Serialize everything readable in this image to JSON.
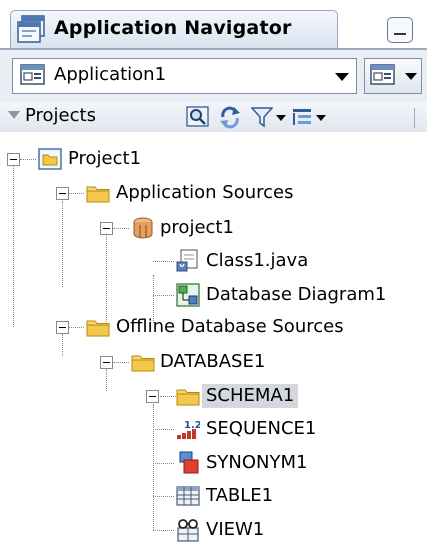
{
  "panel": {
    "title": "Application Navigator"
  },
  "app_selector": {
    "value": "Application1"
  },
  "projects_header": {
    "label": "Projects"
  },
  "tree": {
    "project1_root": "Project1",
    "app_sources": "Application Sources",
    "project1_pkg": "project1",
    "class_file": "Class1.java",
    "db_diagram": "Database Diagram1",
    "offline_db": "Offline Database Sources",
    "database": "DATABASE1",
    "schema": "SCHEMA1",
    "sequence": "SEQUENCE1",
    "synonym": "SYNONYM1",
    "table": "TABLE1",
    "view": "VIEW1"
  },
  "colors": {
    "folder": "#f2c94c",
    "selection": "#d4d8de",
    "header_bg": "#e9eef5"
  }
}
